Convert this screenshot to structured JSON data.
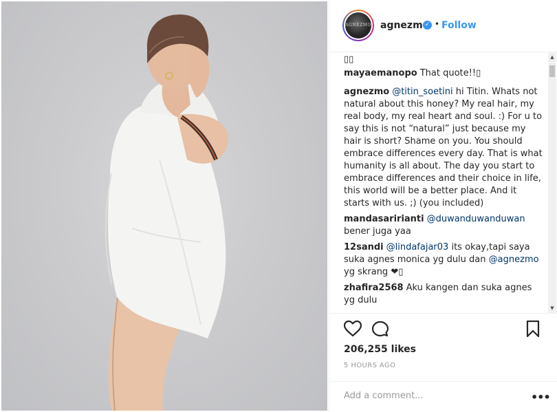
{
  "post": {
    "image_alt": "Woman in oversized white shirt posing against grey backdrop",
    "header": {
      "avatar_text": "AGNEZMO",
      "username": "agnezmo",
      "verified_icon": "verified-badge-icon",
      "separator": "•",
      "follow_label": "Follow"
    },
    "comments": {
      "emoji_line": "▯▯",
      "items": [
        {
          "user": "mayaemanopo",
          "mention": "",
          "text": "That quote!!▯"
        },
        {
          "user": "agnezmo",
          "mention": "@titin_soetini",
          "text": "hi Titin. Whats not natural about this honey? My real hair, my real body, my real heart and soul. :) For u to say this is not “natural” just because my hair is short? Shame on you. You should embrace differences every day. That is what humanity is all about. The day you start to embrace differences and their choice in life, this world will be a better place. And it starts with us. ;) (you included)"
        },
        {
          "user": "mandasaririanti",
          "mention": "@duwanduwanduwan",
          "text": "bener juga yaa"
        },
        {
          "user": "12sandi",
          "mention": "@lindafajar03",
          "text": "its okay,tapi saya suka agnes monica yg dulu dan",
          "mention2": "@agnezmo",
          "text2": "yg skrang ❤▯"
        },
        {
          "user": "zhafira2568",
          "mention": "",
          "text": "Aku kangen dan suka agnes yg dulu"
        }
      ],
      "scroll_up": "▲",
      "scroll_down": "▼"
    },
    "actions": {
      "like_icon": "heart-icon",
      "comment_icon": "speech-bubble-icon",
      "save_icon": "bookmark-icon",
      "likes_text": "206,255 likes",
      "timestamp": "5 HOURS AGO",
      "add_comment_placeholder": "Add a comment...",
      "more_label": "•••"
    }
  }
}
